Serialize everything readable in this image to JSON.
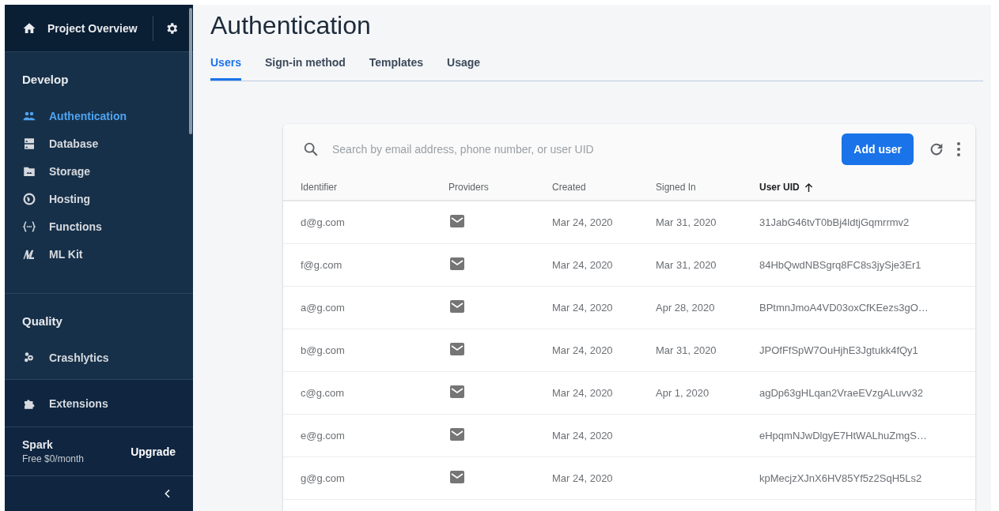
{
  "sidebar": {
    "project": "Project Overview",
    "sections": [
      {
        "title": "Develop",
        "items": [
          {
            "label": "Authentication",
            "selected": true
          },
          {
            "label": "Database",
            "selected": false
          },
          {
            "label": "Storage",
            "selected": false
          },
          {
            "label": "Hosting",
            "selected": false
          },
          {
            "label": "Functions",
            "selected": false
          },
          {
            "label": "ML Kit",
            "selected": false
          }
        ]
      },
      {
        "title": "Quality",
        "items": [
          {
            "label": "Crashlytics",
            "selected": false
          }
        ]
      }
    ],
    "extensions": {
      "label": "Extensions"
    },
    "plan": {
      "name": "Spark",
      "price": "Free $0/month",
      "action": "Upgrade"
    }
  },
  "page": {
    "title": "Authentication",
    "tabs": [
      {
        "label": "Users",
        "selected": true
      },
      {
        "label": "Sign-in method",
        "selected": false
      },
      {
        "label": "Templates",
        "selected": false
      },
      {
        "label": "Usage",
        "selected": false
      }
    ]
  },
  "table": {
    "search": {
      "placeholder": "Search by email address, phone number, or user UID"
    },
    "add_button": "Add user",
    "columns": [
      {
        "label": "Identifier",
        "sorted": false
      },
      {
        "label": "Providers",
        "sorted": false
      },
      {
        "label": "Created",
        "sorted": false
      },
      {
        "label": "Signed In",
        "sorted": false
      },
      {
        "label": "User UID",
        "sorted": true
      }
    ],
    "rows": [
      {
        "identifier": "d@g.com",
        "created": "Mar 24, 2020",
        "signed_in": "Mar 31, 2020",
        "uid": "31JabG46tvT0bBj4ldtjGqmrrmv2"
      },
      {
        "identifier": "f@g.com",
        "created": "Mar 24, 2020",
        "signed_in": "Mar 31, 2020",
        "uid": "84HbQwdNBSgrq8FC8s3jySje3Er1"
      },
      {
        "identifier": "a@g.com",
        "created": "Mar 24, 2020",
        "signed_in": "Apr 28, 2020",
        "uid": "BPtmnJmoA4VD03oxCfKEezs3gO…"
      },
      {
        "identifier": "b@g.com",
        "created": "Mar 24, 2020",
        "signed_in": "Mar 31, 2020",
        "uid": "JPOfFfSpW7OuHjhE3Jgtukk4fQy1"
      },
      {
        "identifier": "c@g.com",
        "created": "Mar 24, 2020",
        "signed_in": "Apr 1, 2020",
        "uid": "agDp63gHLqan2VraeEVzgALuvv32"
      },
      {
        "identifier": "e@g.com",
        "created": "Mar 24, 2020",
        "uid": "eHpqmNJwDlgyE7HtWALhuZmgS…"
      },
      {
        "identifier": "g@g.com",
        "created": "Mar 24, 2020",
        "uid": "kpMecjzXJnX6HV85Yf5z2SqH5Ls2"
      }
    ]
  }
}
